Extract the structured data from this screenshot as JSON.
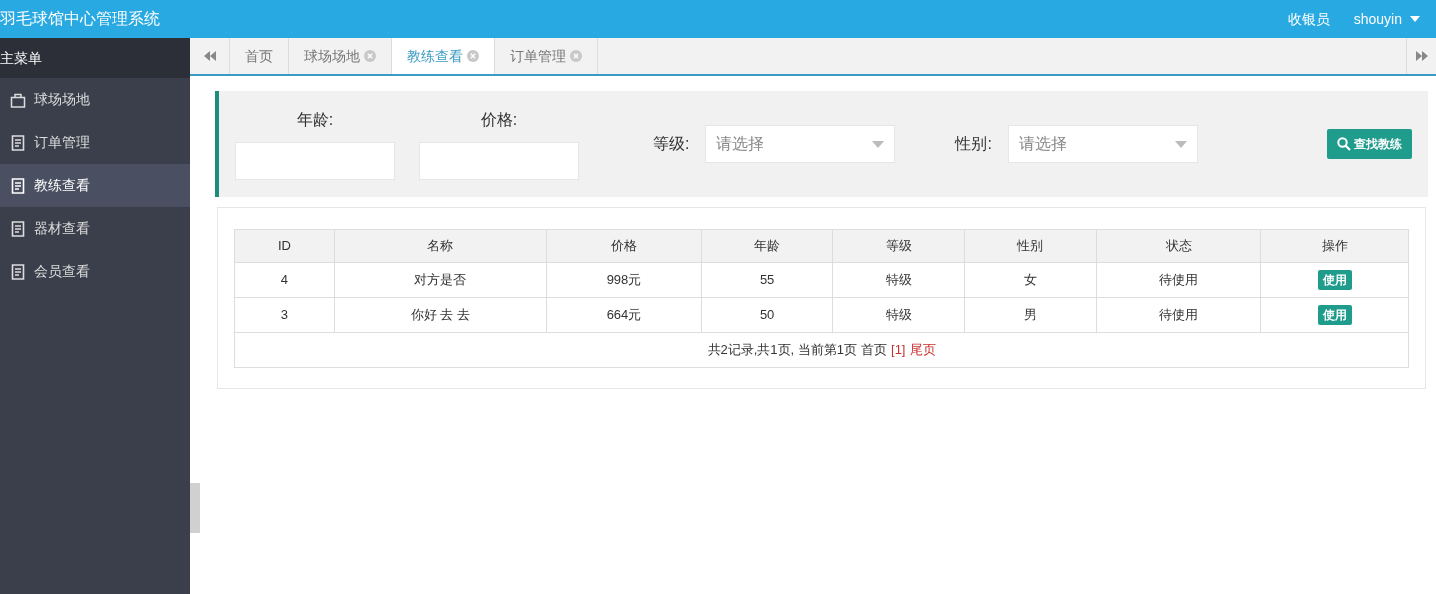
{
  "header": {
    "title": "羽毛球馆中心管理系统",
    "role": "收银员",
    "user": "shouyin"
  },
  "sidebar": {
    "title": "主菜单",
    "items": [
      {
        "label": "球场场地",
        "kind": "bag",
        "selected": false
      },
      {
        "label": "订单管理",
        "kind": "doc",
        "selected": false
      },
      {
        "label": "教练查看",
        "kind": "doc",
        "selected": true
      },
      {
        "label": "器材查看",
        "kind": "doc",
        "selected": false
      },
      {
        "label": "会员查看",
        "kind": "doc",
        "selected": false
      }
    ]
  },
  "tabs": [
    {
      "label": "首页",
      "closable": false,
      "selected": false
    },
    {
      "label": "球场场地",
      "closable": true,
      "selected": false
    },
    {
      "label": "教练查看",
      "closable": true,
      "selected": true
    },
    {
      "label": "订单管理",
      "closable": true,
      "selected": false
    }
  ],
  "filters": {
    "age_label": "年龄:",
    "price_label": "价格:",
    "level_label": "等级:",
    "level_placeholder": "请选择",
    "gender_label": "性别:",
    "gender_placeholder": "请选择",
    "search_button": "查找教练"
  },
  "table": {
    "columns": [
      "ID",
      "名称",
      "价格",
      "年龄",
      "等级",
      "性别",
      "状态",
      "操作"
    ],
    "rows": [
      {
        "cells": [
          "4",
          "对方是否",
          "998元",
          "55",
          "特级",
          "女",
          "待使用"
        ],
        "action": "使用"
      },
      {
        "cells": [
          "3",
          "你好 去 去",
          "664元",
          "50",
          "特级",
          "男",
          "待使用"
        ],
        "action": "使用"
      }
    ],
    "pager": {
      "summary": "共2记录,共1页, 当前第1页",
      "links": [
        {
          "label": "首页",
          "disabled": true
        },
        {
          "label": "[1]",
          "disabled": false
        },
        {
          "label": "尾页",
          "disabled": false
        }
      ]
    }
  }
}
